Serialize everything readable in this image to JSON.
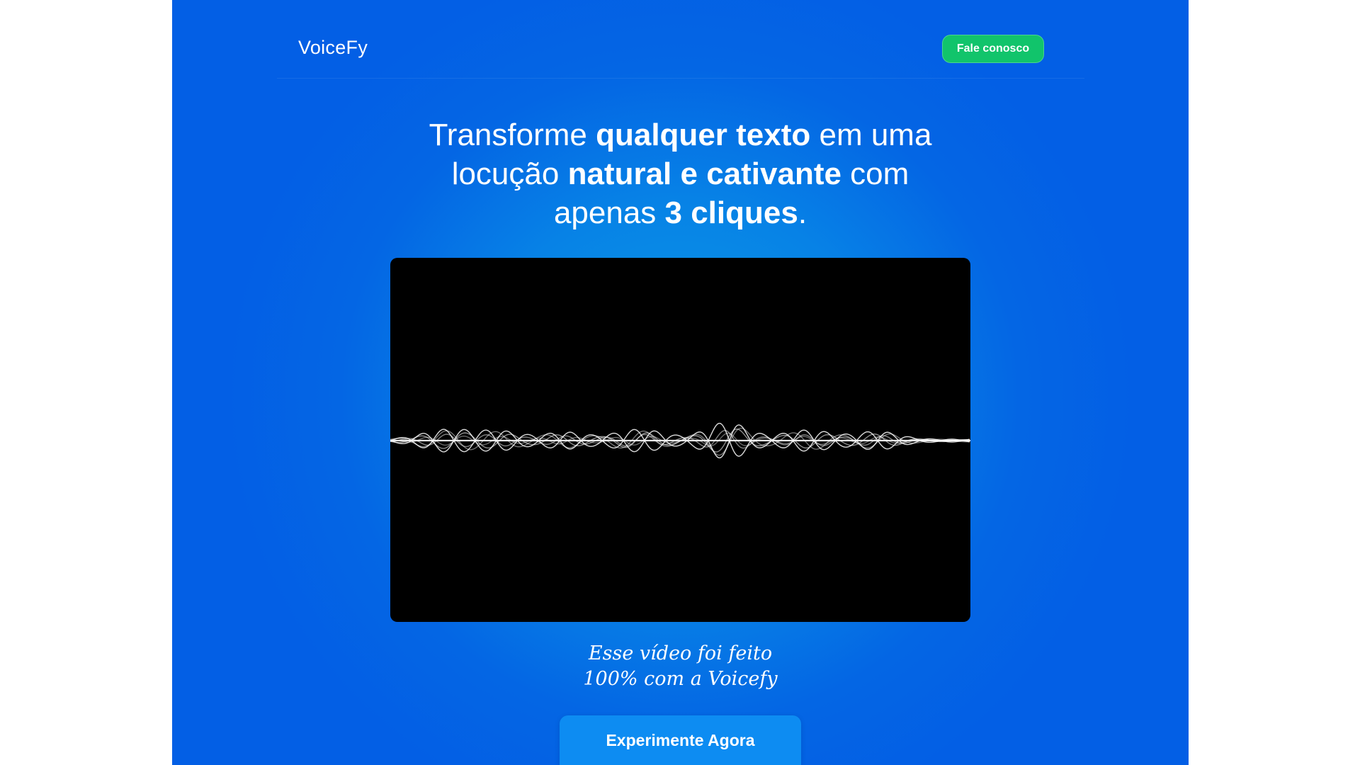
{
  "nav": {
    "brand": "VoiceFy",
    "contact_label": "Fale conosco"
  },
  "hero": {
    "line1_a": "Transforme ",
    "line1_b": "qualquer texto",
    "line1_c": " em uma",
    "line2_a": "locução ",
    "line2_b": "natural e cativante",
    "line2_c": " com",
    "line3_a": "apenas ",
    "line3_b": "3 cliques",
    "line3_c": "."
  },
  "video": {
    "icon": "audio-waveform",
    "background": "#000000"
  },
  "caption": {
    "line1": "Esse vídeo foi feito",
    "line2": "100% com a Voicefy"
  },
  "cta": {
    "label": "Experimente Agora"
  },
  "colors": {
    "accent_green": "#11c46b",
    "cta_blue": "#0d8cf2",
    "background_blue": "#035fe5"
  }
}
